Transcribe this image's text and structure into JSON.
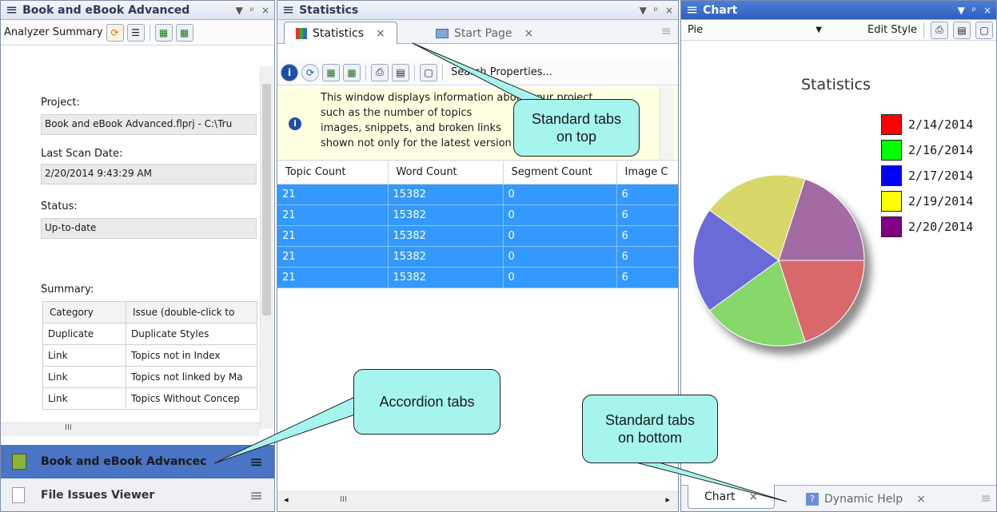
{
  "left_panel": {
    "title": "Book and eBook Advanced",
    "toolbar_label": "Analyzer Summary",
    "project_label": "Project:",
    "project_value": "Book and eBook Advanced.flprj - C:\\Tru",
    "scan_label": "Last Scan Date:",
    "scan_value": "2/20/2014 9:43:29 AM",
    "status_label": "Status:",
    "status_value": "Up-to-date",
    "summary_label": "Summary:",
    "summary_headers": [
      "Category",
      "Issue (double-click to"
    ],
    "summary_rows": [
      [
        "Duplicate",
        "Duplicate Styles"
      ],
      [
        "Link",
        "Topics not in Index"
      ],
      [
        "Link",
        "Topics not linked by Ma"
      ],
      [
        "Link",
        "Topics Without Concep"
      ]
    ],
    "accordion": [
      {
        "label": "Book and eBook Advancec",
        "active": true
      },
      {
        "label": "File Issues Viewer",
        "active": false
      }
    ],
    "hscroll_glyph": "III"
  },
  "middle_panel": {
    "title": "Statistics",
    "tabs": [
      {
        "label": "Statistics",
        "active": true,
        "close": "×"
      },
      {
        "label": "Start Page",
        "active": false,
        "close": "×"
      }
    ],
    "search_label": "Search Properties...",
    "info_text": [
      "This window displays information about your project",
      "such as the number of topics",
      "images, snippets, and broken links",
      "shown not only for the latest version"
    ],
    "columns": [
      "Topic Count",
      "Word Count",
      "Segment Count",
      "Image C"
    ],
    "rows": [
      [
        "21",
        "15382",
        "0",
        "6"
      ],
      [
        "21",
        "15382",
        "0",
        "6"
      ],
      [
        "21",
        "15382",
        "0",
        "6"
      ],
      [
        "21",
        "15382",
        "0",
        "6"
      ],
      [
        "21",
        "15382",
        "0",
        "6"
      ]
    ],
    "hscroll_glyph": "III"
  },
  "right_panel": {
    "title": "Chart",
    "chart_type_select": "Pie",
    "edit_style_label": "Edit Style",
    "bottom_tabs": [
      {
        "label": "Chart",
        "active": true,
        "close": "×"
      },
      {
        "label": "Dynamic Help",
        "active": false,
        "close": "×"
      }
    ]
  },
  "chart_data": {
    "type": "pie",
    "title": "Statistics",
    "legend_position": "top-right",
    "series": [
      {
        "name": "2/14/2014",
        "value": 20,
        "legend_color": "#ff0000",
        "slice_color": "#d8676a"
      },
      {
        "name": "2/16/2014",
        "value": 20,
        "legend_color": "#00ff00",
        "slice_color": "#86d86a"
      },
      {
        "name": "2/17/2014",
        "value": 20,
        "legend_color": "#0000ff",
        "slice_color": "#6a6ad8"
      },
      {
        "name": "2/19/2014",
        "value": 20,
        "legend_color": "#ffff00",
        "slice_color": "#d8d86a"
      },
      {
        "name": "2/20/2014",
        "value": 20,
        "legend_color": "#800080",
        "slice_color": "#a36aa3"
      }
    ]
  },
  "callouts": {
    "tabs_top": "Standard tabs on top",
    "accordion": "Accordion tabs",
    "tabs_bottom": "Standard tabs on bottom"
  },
  "panel_controls": {
    "dropdown": "▼",
    "pin": "ᵖ",
    "close": "×"
  }
}
